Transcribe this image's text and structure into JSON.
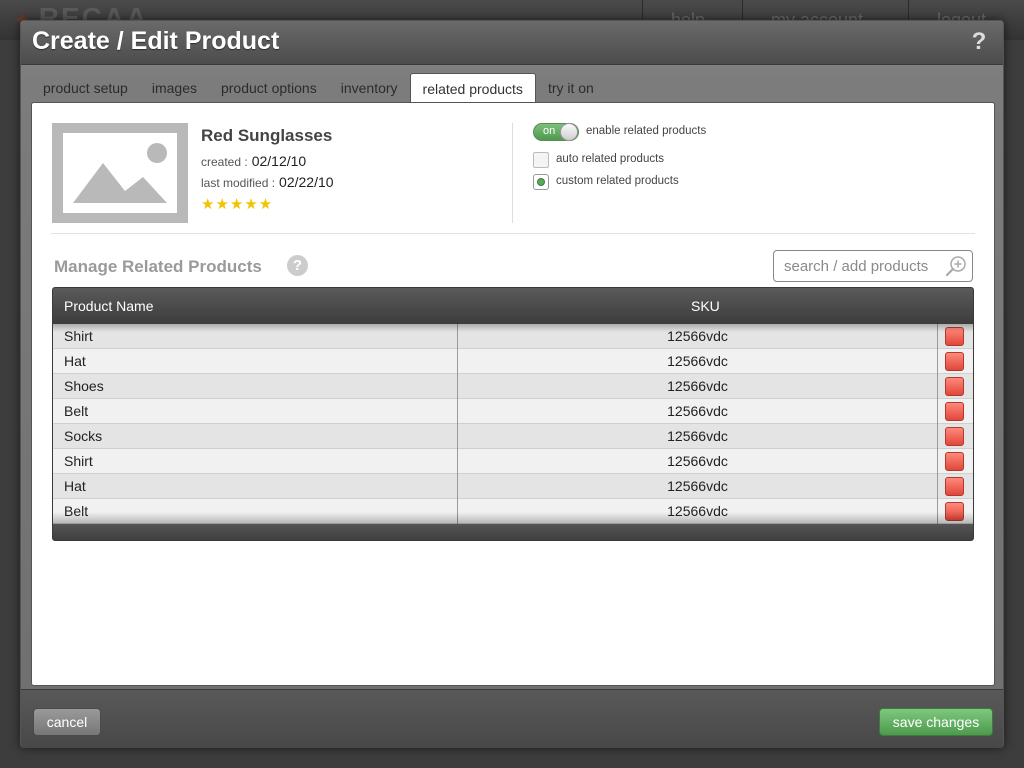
{
  "background": {
    "logo": "RECAA",
    "nav": [
      "help",
      "my account",
      "logout"
    ]
  },
  "modal": {
    "title": "Create / Edit Product",
    "help_icon": "?"
  },
  "tabs": [
    {
      "label": "product setup",
      "active": false
    },
    {
      "label": "images",
      "active": false
    },
    {
      "label": "product options",
      "active": false
    },
    {
      "label": "inventory",
      "active": false
    },
    {
      "label": "related products",
      "active": true
    },
    {
      "label": "try it on",
      "active": false
    }
  ],
  "product": {
    "name": "Red Sunglasses",
    "created_label": "created :",
    "created_value": "02/12/10",
    "modified_label": "last modified :",
    "modified_value": "02/22/10",
    "rating": 5,
    "stars": "★★★★★"
  },
  "options": {
    "toggle_label": "on",
    "enable_label": "enable related products",
    "auto_label": "auto related products",
    "custom_label": "custom related products",
    "auto_checked": false,
    "custom_selected": true
  },
  "manage": {
    "title": "Manage Related Products",
    "help_icon": "?",
    "search_placeholder": "search / add products"
  },
  "table": {
    "headers": [
      "Product Name",
      "SKU"
    ],
    "rows": [
      {
        "name": "Shirt",
        "sku": "12566vdc"
      },
      {
        "name": "Hat",
        "sku": "12566vdc"
      },
      {
        "name": "Shoes",
        "sku": "12566vdc"
      },
      {
        "name": "Belt",
        "sku": "12566vdc"
      },
      {
        "name": "Socks",
        "sku": "12566vdc"
      },
      {
        "name": "Shirt",
        "sku": "12566vdc"
      },
      {
        "name": "Hat",
        "sku": "12566vdc"
      },
      {
        "name": "Belt",
        "sku": "12566vdc"
      }
    ]
  },
  "footer": {
    "cancel_label": "cancel",
    "save_label": "save changes"
  },
  "colors": {
    "accent_green": "#5aaa5a",
    "delete_red": "#e0473a",
    "star_yellow": "#f2c400"
  }
}
